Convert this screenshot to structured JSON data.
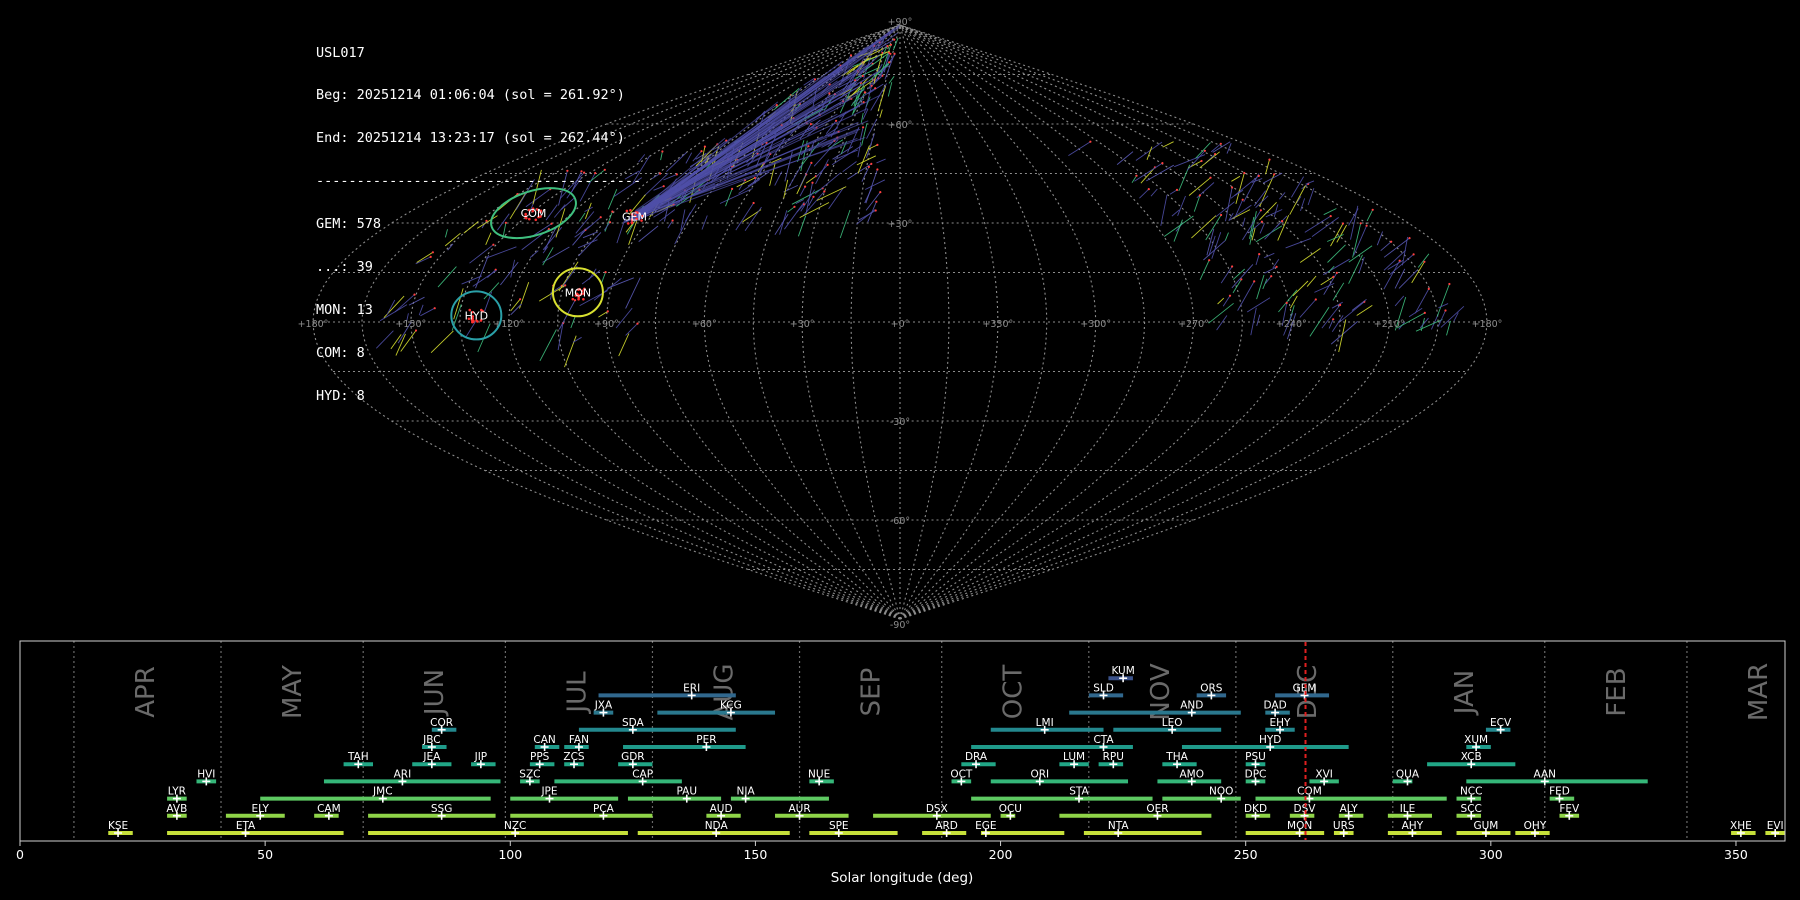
{
  "stats": {
    "station": "USL017",
    "beg": "Beg: 20251214 01:06:04 (sol = 261.92°)",
    "end": "End: 20251214 13:23:17 (sol = 262.44°)",
    "divider": "----------------------------------------",
    "counts": [
      "GEM: 578",
      "...: 39",
      "MON: 13",
      "COM: 8",
      "HYD: 8"
    ]
  },
  "colors": {
    "background": "#000000",
    "grid": "#8c8c8c",
    "tracks": "#4f4fa8",
    "month": "#6a6a6a",
    "current_sol_line": "#e02020"
  },
  "chart_data": [
    {
      "type": "scatter",
      "projection": "sinusoidal",
      "lon_ticks": [
        "+180°",
        "+150°",
        "+120°",
        "+90°",
        "+60°",
        "+30°",
        "+0°",
        "+330°",
        "+300°",
        "+270°",
        "+240°",
        "+210°",
        "+180°"
      ],
      "lat_ticks": [
        "+90°",
        "+60°",
        "+30°",
        "-30°",
        "-60°",
        "-90°"
      ],
      "radiants": [
        {
          "name": "COM",
          "lon": 134,
          "lat": 33,
          "color": "#3fbf7f"
        },
        {
          "name": "GEM",
          "lon": 96,
          "lat": 32,
          "color": "#ff3030"
        },
        {
          "name": "MON",
          "lon": 100,
          "lat": 9,
          "color": "#d8e030"
        },
        {
          "name": "HYD",
          "lon": 130,
          "lat": 2,
          "color": "#2aa0a8"
        }
      ]
    },
    {
      "type": "bar",
      "xlabel": "Solar longitude (deg)",
      "xlim": [
        0,
        360
      ],
      "x_ticks": [
        0,
        50,
        100,
        150,
        200,
        250,
        300,
        350
      ],
      "current_sol": 262.2,
      "months": [
        {
          "label": "APR",
          "start": 11
        },
        {
          "label": "MAY",
          "start": 41
        },
        {
          "label": "JUN",
          "start": 70
        },
        {
          "label": "JUL",
          "start": 99
        },
        {
          "label": "AUG",
          "start": 129
        },
        {
          "label": "SEP",
          "start": 159
        },
        {
          "label": "OCT",
          "start": 188
        },
        {
          "label": "NOV",
          "start": 218
        },
        {
          "label": "DEC",
          "start": 248
        },
        {
          "label": "JAN",
          "start": 280
        },
        {
          "label": "FEB",
          "start": 311
        },
        {
          "label": "MAR",
          "start": 340
        }
      ],
      "showers": [
        {
          "code": "KUM",
          "start": 222,
          "end": 227,
          "peak": 225,
          "row": 9
        },
        {
          "code": "ERI",
          "start": 118,
          "end": 146,
          "peak": 137,
          "row": 8
        },
        {
          "code": "SLD",
          "start": 218,
          "end": 225,
          "peak": 221,
          "row": 8
        },
        {
          "code": "ORS",
          "start": 240,
          "end": 246,
          "peak": 243,
          "row": 8
        },
        {
          "code": "GEM",
          "start": 256,
          "end": 267,
          "peak": 262,
          "row": 8
        },
        {
          "code": "JXA",
          "start": 117,
          "end": 121,
          "peak": 119,
          "row": 7
        },
        {
          "code": "KCG",
          "start": 130,
          "end": 154,
          "peak": 145,
          "row": 7
        },
        {
          "code": "AND",
          "start": 214,
          "end": 249,
          "peak": 239,
          "row": 7
        },
        {
          "code": "DAD",
          "start": 254,
          "end": 259,
          "peak": 256,
          "row": 7
        },
        {
          "code": "COR",
          "start": 84,
          "end": 89,
          "peak": 86,
          "row": 6
        },
        {
          "code": "SDA",
          "start": 114,
          "end": 146,
          "peak": 125,
          "row": 6
        },
        {
          "code": "LMI",
          "start": 198,
          "end": 221,
          "peak": 209,
          "row": 6
        },
        {
          "code": "LEO",
          "start": 223,
          "end": 245,
          "peak": 235,
          "row": 6
        },
        {
          "code": "EHY",
          "start": 254,
          "end": 260,
          "peak": 257,
          "row": 6
        },
        {
          "code": "ECV",
          "start": 299,
          "end": 304,
          "peak": 302,
          "row": 6
        },
        {
          "code": "JBC",
          "start": 82,
          "end": 87,
          "peak": 84,
          "row": 5
        },
        {
          "code": "CAN",
          "start": 105,
          "end": 110,
          "peak": 107,
          "row": 5
        },
        {
          "code": "FAN",
          "start": 111,
          "end": 116,
          "peak": 114,
          "row": 5
        },
        {
          "code": "PER",
          "start": 123,
          "end": 148,
          "peak": 140,
          "row": 5
        },
        {
          "code": "CTA",
          "start": 194,
          "end": 227,
          "peak": 221,
          "row": 5
        },
        {
          "code": "HYD",
          "start": 237,
          "end": 271,
          "peak": 255,
          "row": 5
        },
        {
          "code": "XUM",
          "start": 295,
          "end": 300,
          "peak": 297,
          "row": 5
        },
        {
          "code": "TAH",
          "start": 66,
          "end": 72,
          "peak": 69,
          "row": 4
        },
        {
          "code": "JEA",
          "start": 80,
          "end": 88,
          "peak": 84,
          "row": 4
        },
        {
          "code": "JIP",
          "start": 92,
          "end": 97,
          "peak": 94,
          "row": 4
        },
        {
          "code": "PPS",
          "start": 104,
          "end": 109,
          "peak": 106,
          "row": 4
        },
        {
          "code": "ZCS",
          "start": 111,
          "end": 115,
          "peak": 113,
          "row": 4
        },
        {
          "code": "GDR",
          "start": 122,
          "end": 129,
          "peak": 125,
          "row": 4
        },
        {
          "code": "DRA",
          "start": 192,
          "end": 199,
          "peak": 195,
          "row": 4
        },
        {
          "code": "LUM",
          "start": 212,
          "end": 218,
          "peak": 215,
          "row": 4
        },
        {
          "code": "RPU",
          "start": 220,
          "end": 225,
          "peak": 223,
          "row": 4
        },
        {
          "code": "THA",
          "start": 233,
          "end": 240,
          "peak": 236,
          "row": 4
        },
        {
          "code": "PSU",
          "start": 250,
          "end": 254,
          "peak": 252,
          "row": 4
        },
        {
          "code": "XCB",
          "start": 287,
          "end": 305,
          "peak": 296,
          "row": 4
        },
        {
          "code": "HVI",
          "start": 36,
          "end": 40,
          "peak": 38,
          "row": 3
        },
        {
          "code": "ARI",
          "start": 62,
          "end": 98,
          "peak": 78,
          "row": 3
        },
        {
          "code": "SZC",
          "start": 102,
          "end": 106,
          "peak": 104,
          "row": 3
        },
        {
          "code": "CAP",
          "start": 109,
          "end": 135,
          "peak": 127,
          "row": 3
        },
        {
          "code": "NUE",
          "start": 161,
          "end": 166,
          "peak": 163,
          "row": 3
        },
        {
          "code": "OCT",
          "start": 190,
          "end": 194,
          "peak": 192,
          "row": 3
        },
        {
          "code": "ORI",
          "start": 198,
          "end": 226,
          "peak": 208,
          "row": 3
        },
        {
          "code": "AMO",
          "start": 232,
          "end": 245,
          "peak": 239,
          "row": 3
        },
        {
          "code": "DPC",
          "start": 250,
          "end": 254,
          "peak": 252,
          "row": 3
        },
        {
          "code": "XVI",
          "start": 263,
          "end": 269,
          "peak": 266,
          "row": 3
        },
        {
          "code": "QUA",
          "start": 280,
          "end": 284,
          "peak": 283,
          "row": 3
        },
        {
          "code": "AAN",
          "start": 295,
          "end": 332,
          "peak": 311,
          "row": 3
        },
        {
          "code": "LYR",
          "start": 30,
          "end": 34,
          "peak": 32,
          "row": 2
        },
        {
          "code": "JMC",
          "start": 49,
          "end": 96,
          "peak": 74,
          "row": 2
        },
        {
          "code": "JPE",
          "start": 100,
          "end": 122,
          "peak": 108,
          "row": 2
        },
        {
          "code": "PAU",
          "start": 124,
          "end": 143,
          "peak": 136,
          "row": 2
        },
        {
          "code": "NIA",
          "start": 145,
          "end": 165,
          "peak": 148,
          "row": 2
        },
        {
          "code": "STA",
          "start": 194,
          "end": 231,
          "peak": 216,
          "row": 2
        },
        {
          "code": "NOO",
          "start": 233,
          "end": 249,
          "peak": 245,
          "row": 2
        },
        {
          "code": "COM",
          "start": 252,
          "end": 291,
          "peak": 263,
          "row": 2
        },
        {
          "code": "NCC",
          "start": 293,
          "end": 298,
          "peak": 296,
          "row": 2
        },
        {
          "code": "FED",
          "start": 312,
          "end": 317,
          "peak": 314,
          "row": 2
        },
        {
          "code": "AVB",
          "start": 30,
          "end": 34,
          "peak": 32,
          "row": 1
        },
        {
          "code": "ELY",
          "start": 42,
          "end": 54,
          "peak": 49,
          "row": 1
        },
        {
          "code": "CAM",
          "start": 60,
          "end": 65,
          "peak": 63,
          "row": 1
        },
        {
          "code": "SSG",
          "start": 71,
          "end": 97,
          "peak": 86,
          "row": 1
        },
        {
          "code": "PCA",
          "start": 100,
          "end": 129,
          "peak": 119,
          "row": 1
        },
        {
          "code": "AUD",
          "start": 140,
          "end": 147,
          "peak": 143,
          "row": 1
        },
        {
          "code": "AUR",
          "start": 154,
          "end": 169,
          "peak": 159,
          "row": 1
        },
        {
          "code": "DSX",
          "start": 174,
          "end": 198,
          "peak": 187,
          "row": 1
        },
        {
          "code": "OCU",
          "start": 200,
          "end": 203,
          "peak": 202,
          "row": 1
        },
        {
          "code": "OER",
          "start": 212,
          "end": 243,
          "peak": 232,
          "row": 1
        },
        {
          "code": "DKD",
          "start": 250,
          "end": 255,
          "peak": 252,
          "row": 1
        },
        {
          "code": "DSV",
          "start": 259,
          "end": 264,
          "peak": 262,
          "row": 1
        },
        {
          "code": "ALY",
          "start": 269,
          "end": 274,
          "peak": 271,
          "row": 1
        },
        {
          "code": "ILE",
          "start": 279,
          "end": 288,
          "peak": 283,
          "row": 1
        },
        {
          "code": "SCC",
          "start": 293,
          "end": 298,
          "peak": 296,
          "row": 1
        },
        {
          "code": "FEV",
          "start": 314,
          "end": 318,
          "peak": 316,
          "row": 1
        },
        {
          "code": "KSE",
          "start": 18,
          "end": 23,
          "peak": 20,
          "row": 0
        },
        {
          "code": "ETA",
          "start": 30,
          "end": 66,
          "peak": 46,
          "row": 0
        },
        {
          "code": "NZC",
          "start": 71,
          "end": 124,
          "peak": 101,
          "row": 0
        },
        {
          "code": "NDA",
          "start": 126,
          "end": 157,
          "peak": 142,
          "row": 0
        },
        {
          "code": "SPE",
          "start": 161,
          "end": 179,
          "peak": 167,
          "row": 0
        },
        {
          "code": "ARD",
          "start": 184,
          "end": 193,
          "peak": 189,
          "row": 0
        },
        {
          "code": "EGE",
          "start": 196,
          "end": 213,
          "peak": 197,
          "row": 0
        },
        {
          "code": "NTA",
          "start": 217,
          "end": 241,
          "peak": 224,
          "row": 0
        },
        {
          "code": "MON",
          "start": 250,
          "end": 266,
          "peak": 261,
          "row": 0
        },
        {
          "code": "URS",
          "start": 268,
          "end": 272,
          "peak": 270,
          "row": 0
        },
        {
          "code": "AHY",
          "start": 279,
          "end": 290,
          "peak": 284,
          "row": 0
        },
        {
          "code": "GUM",
          "start": 293,
          "end": 304,
          "peak": 299,
          "row": 0
        },
        {
          "code": "OHY",
          "start": 305,
          "end": 312,
          "peak": 309,
          "row": 0
        },
        {
          "code": "XHE",
          "start": 349,
          "end": 354,
          "peak": 351,
          "row": 0
        },
        {
          "code": "EVI",
          "start": 356,
          "end": 360,
          "peak": 358,
          "row": 0
        }
      ]
    }
  ]
}
